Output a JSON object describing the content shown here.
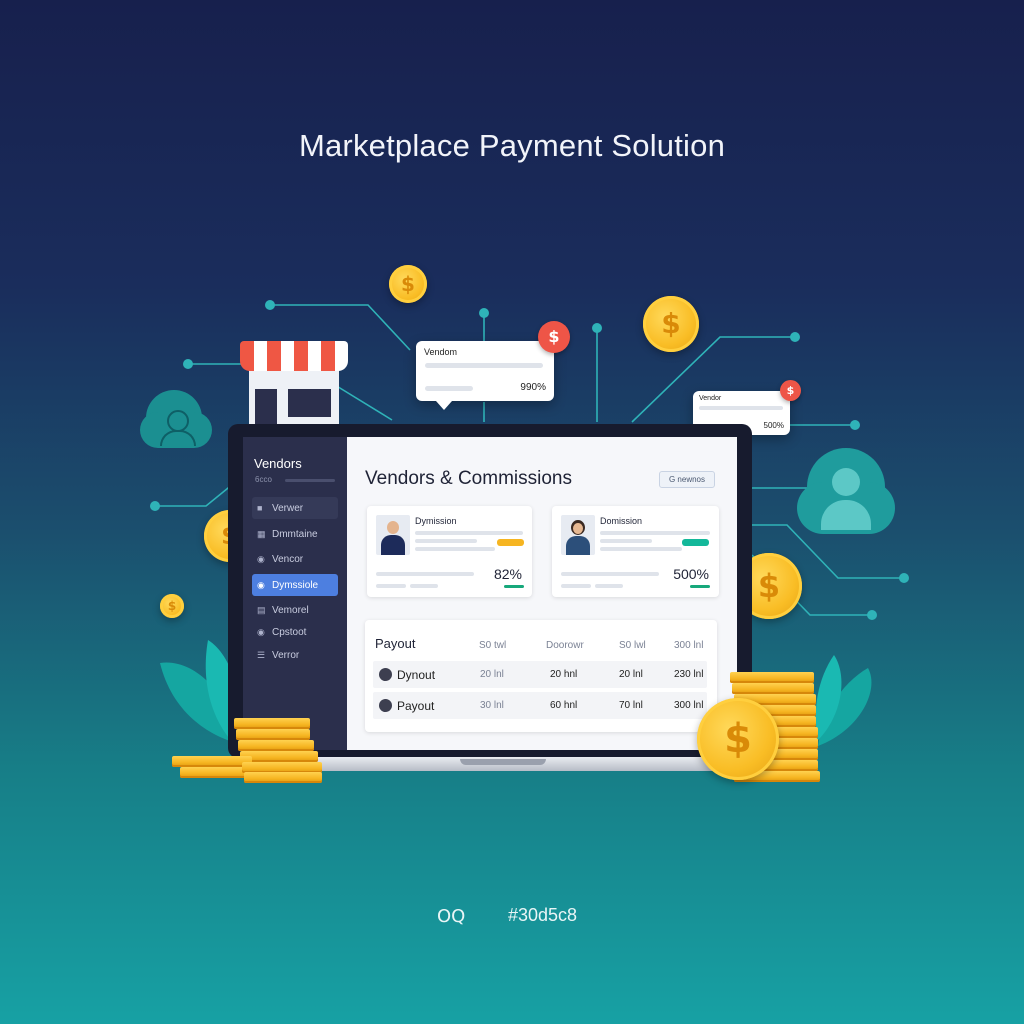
{
  "title": "Marketplace Payment Solution",
  "bubble_left": {
    "title": "Vendom",
    "value": "990%",
    "badge": "$"
  },
  "bubble_right": {
    "title": "Vendor",
    "value": "500%",
    "badge": "$"
  },
  "coins": {
    "symbol": "$"
  },
  "sidebar": {
    "title": "Vendors",
    "subtitle": "6cco",
    "items": [
      {
        "label": "Verwer",
        "icon": "user-icon"
      },
      {
        "label": "Dmmtaine",
        "icon": "grid-icon"
      },
      {
        "label": "Vencor",
        "icon": "users-icon"
      },
      {
        "label": "Dymssiole",
        "icon": "users-icon",
        "active": true
      },
      {
        "label": "Vemorel",
        "icon": "table-icon"
      },
      {
        "label": "Cpstoot",
        "icon": "users-icon"
      },
      {
        "label": "Verror",
        "icon": "list-icon"
      }
    ]
  },
  "main": {
    "heading": "Vendors & Commissions",
    "action_button": "G newnos",
    "cards": [
      {
        "title": "Dymission",
        "value": "82%",
        "pill_color": "#f6b521",
        "bar_color": "#17a87b"
      },
      {
        "title": "Domission",
        "value": "500%",
        "pill_color": "#14b89a",
        "bar_color": "#17a87b"
      }
    ],
    "payout": {
      "title": "Payout",
      "columns": [
        "S0 twl",
        "Doorowr",
        "S0 lwl",
        "300 lnl"
      ],
      "rows": [
        {
          "name": "Dynout",
          "cells": [
            "20 lnl",
            "20 hnl",
            "20 lnl",
            "230 lnl"
          ]
        },
        {
          "name": "Payout",
          "cells": [
            "30 lnl",
            "60 hnl",
            "70 lnl",
            "300 lnl"
          ]
        }
      ]
    }
  },
  "footer": {
    "icons": "OQ",
    "hex": "#30d5c8"
  },
  "colors": {
    "accent_blue": "#4d7fe0",
    "teal": "#1b8f91",
    "coin_gold": "#f9bd25",
    "badge_red": "#ee5547"
  }
}
